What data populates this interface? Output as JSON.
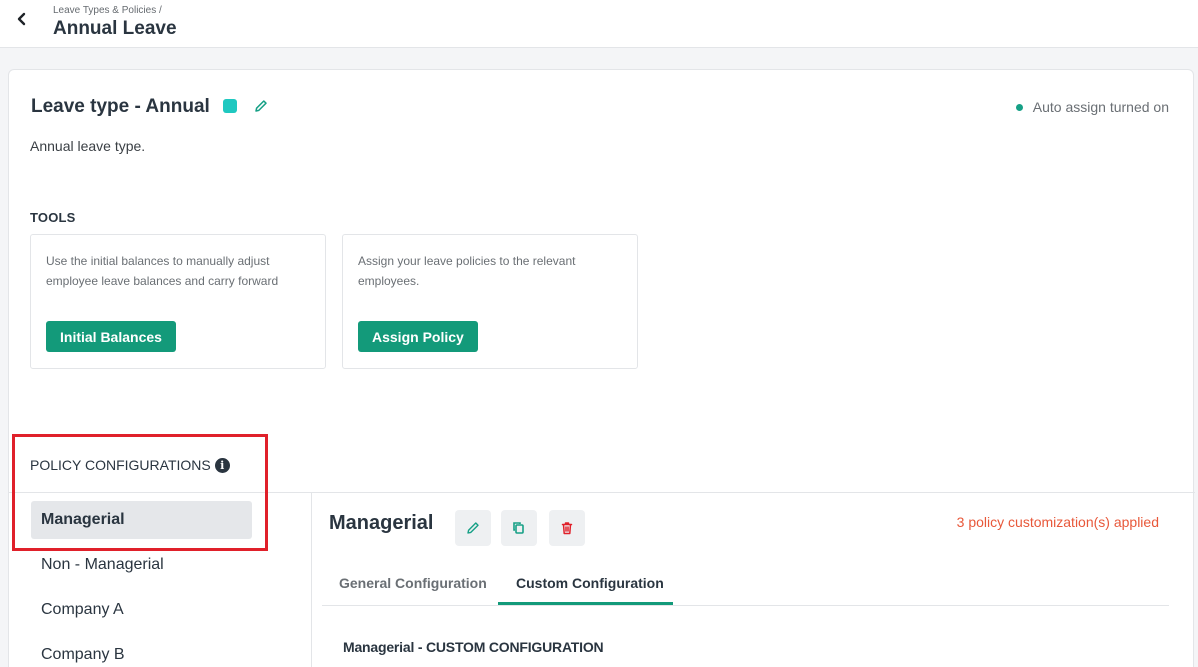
{
  "header": {
    "breadcrumb": "Leave Types & Policies /",
    "title": "Annual Leave",
    "back_icon": "chevron-left-icon"
  },
  "leave_type": {
    "title": "Leave type - Annual",
    "color": "#1fc8c0",
    "description": "Annual leave type.",
    "auto_assign_status": "Auto assign turned on",
    "status_color": "#16a086"
  },
  "tools": {
    "heading": "TOOLS",
    "cards": [
      {
        "description": "Use the initial balances to manually adjust employee leave balances and carry forward",
        "button_label": "Initial Balances"
      },
      {
        "description": "Assign your leave policies to the relevant employees.",
        "button_label": "Assign Policy"
      }
    ]
  },
  "policy_configurations": {
    "heading": "POLICY CONFIGURATIONS",
    "items": [
      "Managerial",
      "Non - Managerial",
      "Company A",
      "Company B"
    ],
    "selected": "Managerial"
  },
  "detail": {
    "title": "Managerial",
    "customizations": "3 policy customization(s) applied",
    "tabs": [
      "General Configuration",
      "Custom Configuration"
    ],
    "active_tab": "Custom Configuration",
    "section_heading": "Managerial - CUSTOM CONFIGURATION"
  },
  "colors": {
    "accent": "#139a7a",
    "warning_text": "#e8583a",
    "delete": "#e0202a",
    "highlight": "#e0202a"
  }
}
